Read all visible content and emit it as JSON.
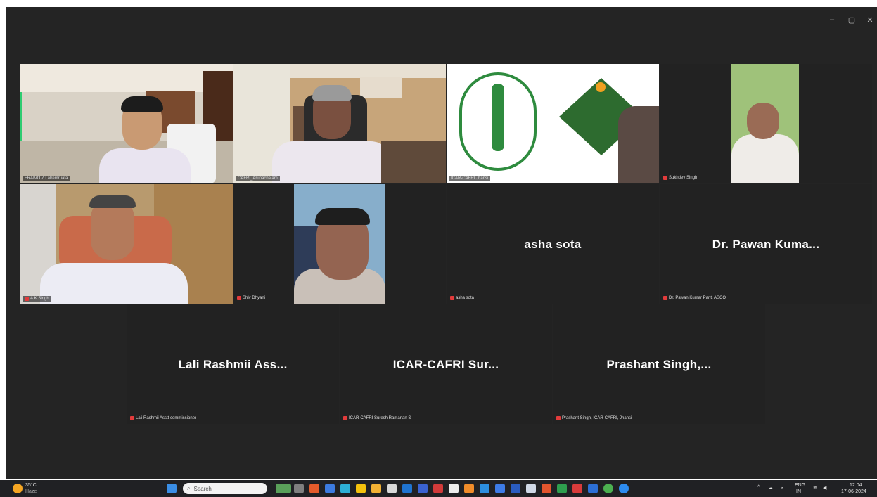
{
  "window": {
    "controls": {
      "minimize": "–",
      "restore": "▢",
      "close": "✕"
    }
  },
  "participants": [
    {
      "id": "p1",
      "label": "FRAIVO Z.Lalremruata"
    },
    {
      "id": "p2",
      "label": "CAFRI_Arunachalam"
    },
    {
      "id": "p3",
      "label": "ICAR-CAFRI Jhansi"
    },
    {
      "id": "p4",
      "label": "Sukhdev Singh"
    },
    {
      "id": "p5",
      "label": "A.K.Singh"
    },
    {
      "id": "p6",
      "label": "Shiv Dhyani"
    },
    {
      "id": "p7",
      "display": "asha sota",
      "label": "asha sota"
    },
    {
      "id": "p8",
      "display": "Dr. Pawan Kuma...",
      "label": "Dr. Pawan Kumar Pant, ASCO"
    },
    {
      "id": "p9",
      "display": "Lali Rashmii Ass...",
      "label": "Lali Rashmii Asstt commissioner"
    },
    {
      "id": "p10",
      "display": "ICAR-CAFRI Sur...",
      "label": "ICAR-CAFRI Suresh Ramanan S"
    },
    {
      "id": "p11",
      "display": "Prashant Singh,...",
      "label": "Prashant Singh, ICAR-CAFRI, Jhansi"
    }
  ],
  "taskbar": {
    "weather_temp": "35°C",
    "weather_desc": "Haze",
    "search_placeholder": "Search",
    "tray_lang": "ENG",
    "tray_region": "IN",
    "time": "12:04",
    "date": "17-06-2024",
    "colors": {
      "background": "#202124",
      "accent": "#2ecc71",
      "mute": "#e23b3b"
    }
  }
}
